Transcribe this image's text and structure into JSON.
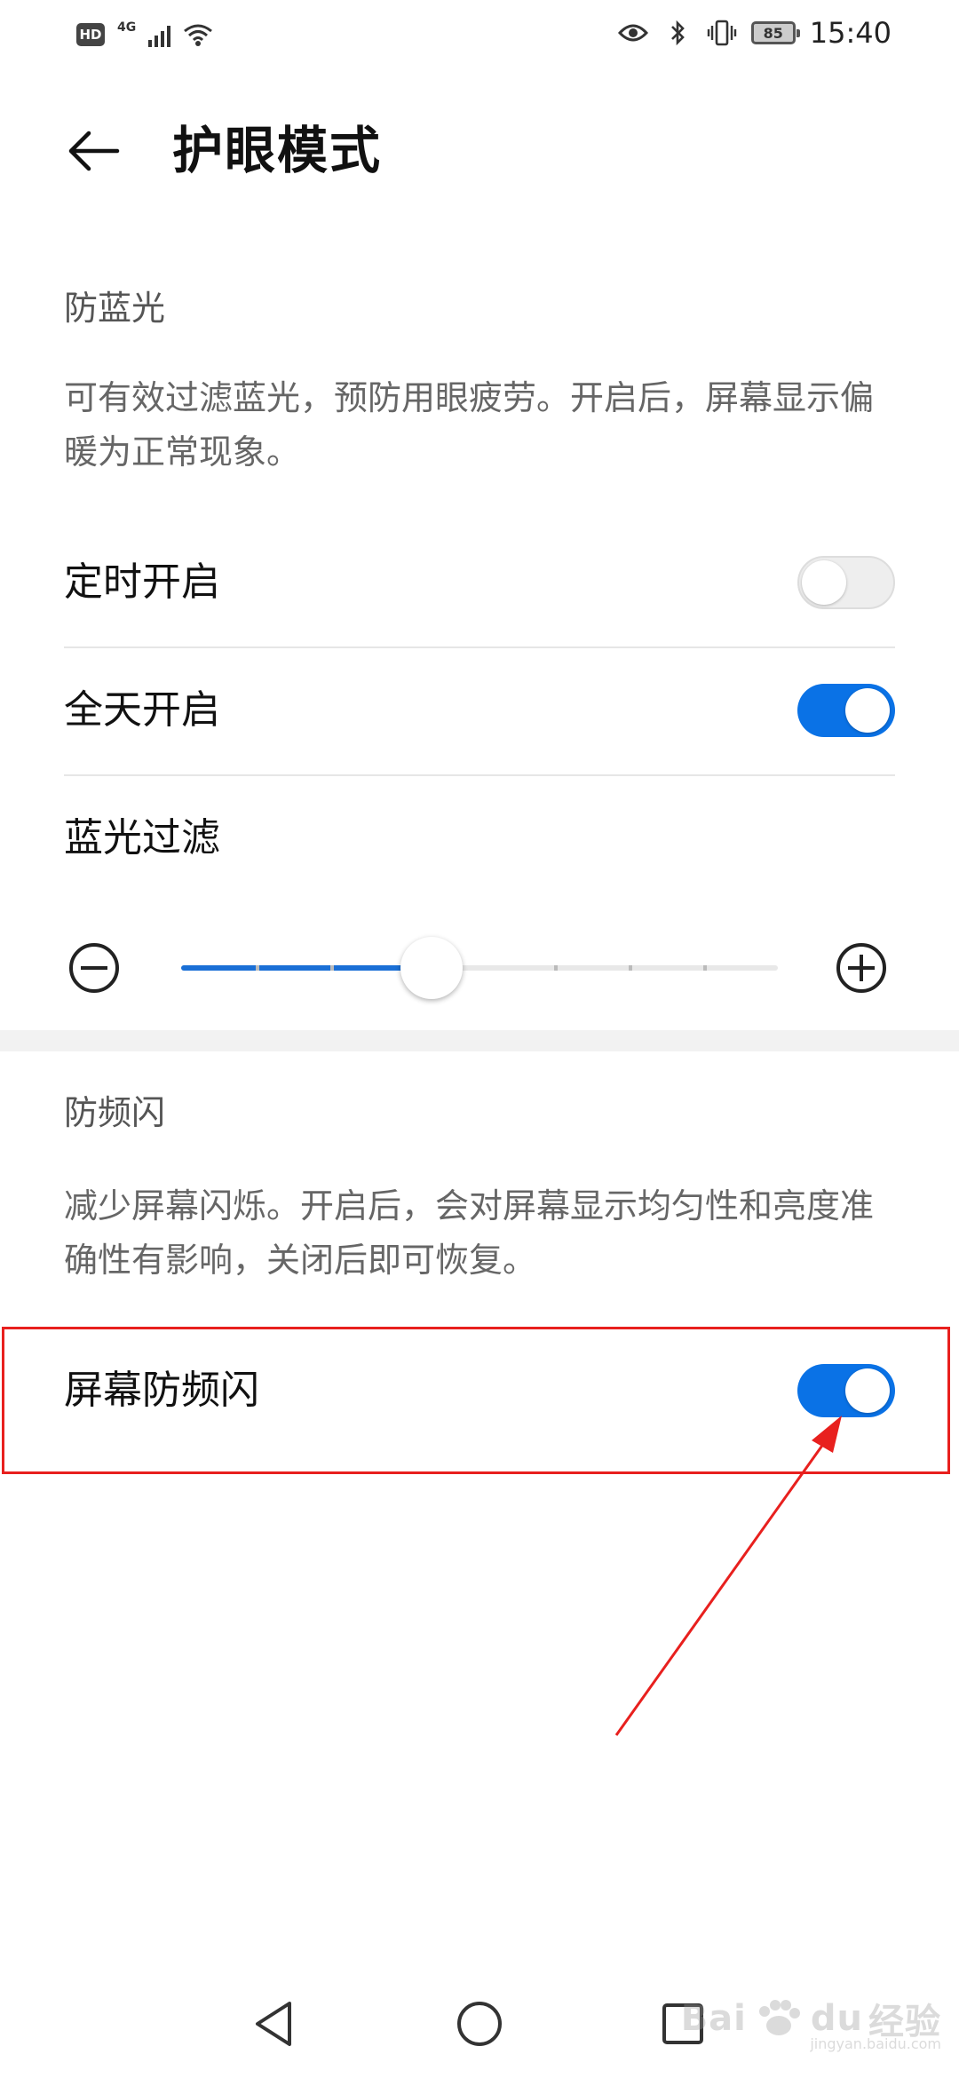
{
  "status_bar": {
    "hd": "HD",
    "network": "4G",
    "battery": "85",
    "time": "15:40"
  },
  "header": {
    "title": "护眼模式"
  },
  "blue_light": {
    "section_title": "防蓝光",
    "description": "可有效过滤蓝光，预防用眼疲劳。开启后，屏幕显示偏暖为正常现象。",
    "scheduled_label": "定时开启",
    "scheduled_on": false,
    "all_day_label": "全天开启",
    "all_day_on": true,
    "filter_label": "蓝光过滤",
    "filter_level": 0.42
  },
  "flicker": {
    "section_title": "防频闪",
    "description": "减少屏幕闪烁。开启后，会对屏幕显示均匀性和亮度准确性有影响，关闭后即可恢复。",
    "toggle_label": "屏幕防频闪",
    "toggle_on": true
  },
  "watermark": {
    "brand": "Bai",
    "brand2": "du",
    "suffix": "经验",
    "url": "jingyan.baidu.com"
  },
  "colors": {
    "accent": "#0a72e6",
    "highlight": "#e8201e"
  }
}
